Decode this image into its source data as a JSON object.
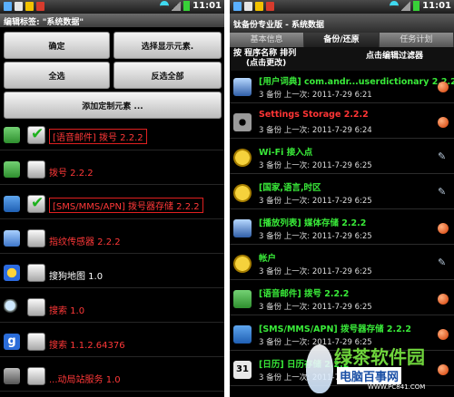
{
  "status": {
    "time": "11:01"
  },
  "left": {
    "title": "编辑标签: \"系统数据\"",
    "buttons": {
      "ok": "确定",
      "select_shown": "选择显示元素.",
      "select_all": "全选",
      "invert_all": "反选全部",
      "add_custom": "添加定制元素 ..."
    },
    "rows": [
      {
        "label": "[语音邮件] 拨号 2.2.2",
        "checked": true,
        "color": "red",
        "boxed": true,
        "icon": "phone-dialer-icon"
      },
      {
        "label": "拨号 2.2.2",
        "checked": false,
        "color": "red",
        "boxed": false,
        "icon": "phone-dialer-icon"
      },
      {
        "label": "[SMS/MMS/APN] 拨号器存储 2.2.2",
        "checked": true,
        "color": "red",
        "boxed": true,
        "icon": "phone-call-icon"
      },
      {
        "label": "指纹传感器 2.2.2",
        "checked": false,
        "color": "red",
        "boxed": false,
        "icon": "screen-icon"
      },
      {
        "label": "搜狗地图 1.0",
        "checked": false,
        "color": "white",
        "boxed": false,
        "icon": "sogou-map-icon"
      },
      {
        "label": "搜索 1.0",
        "checked": false,
        "color": "red",
        "boxed": false,
        "icon": "magnifier-icon"
      },
      {
        "label": "搜索 1.1.2.64376",
        "checked": false,
        "color": "red",
        "boxed": false,
        "icon": "google-icon"
      },
      {
        "label": "...动局站服务 1.0",
        "checked": false,
        "color": "red",
        "boxed": false,
        "icon": "app-icon"
      }
    ]
  },
  "right": {
    "title": "钛备份专业版 - 系统数据",
    "tabs": [
      "基本信息",
      "备份/还原",
      "任务计划"
    ],
    "sort": {
      "line1": "按 程序名称 排列",
      "line2": "(点击更改)",
      "filter": "点击编辑过滤器"
    },
    "apps": [
      {
        "name": "[用户词典] com.andr...userdictionary 2.2.2",
        "info": "3 备份 上一次: 2011-7-29 6:21",
        "color": "green",
        "mark": "dot",
        "icon": "monitor-icon"
      },
      {
        "name": "Settings Storage 2.2.2",
        "info": "3 备份 上一次: 2011-7-29 6:24",
        "color": "red",
        "mark": "dot",
        "icon": "gear-icon"
      },
      {
        "name": "Wi-Fi 接入点",
        "info": "3 备份 上一次: 2011-7-29 6:25",
        "color": "green",
        "mark": "pen",
        "icon": "sys-badge-icon"
      },
      {
        "name": "[国家,语言,时区",
        "info": "3 备份 上一次: 2011-7-29 6:25",
        "color": "green",
        "mark": "pen",
        "icon": "sys-badge-icon"
      },
      {
        "name": "[播放列表] 媒体存储 2.2.2",
        "info": "3 备份 上一次: 2011-7-29 6:25",
        "color": "green",
        "mark": "dot",
        "icon": "monitor-icon"
      },
      {
        "name": "帐户",
        "info": "3 备份 上一次: 2011-7-29 6:25",
        "color": "green",
        "mark": "pen",
        "icon": "sys-badge-icon"
      },
      {
        "name": "[语音邮件] 拨号 2.2.2",
        "info": "3 备份 上一次: 2011-7-29 6:25",
        "color": "green",
        "mark": "dot",
        "icon": "phone-dialer-icon"
      },
      {
        "name": "[SMS/MMS/APN] 拨号器存储 2.2.2",
        "info": "3 备份 上一次: 2011-7-29 6:25",
        "color": "green",
        "mark": "dot",
        "icon": "phone-call-icon"
      },
      {
        "name": "[日历] 日历存储 2.2.2",
        "info": "3 备份 上一次: 2011-7-29 6:25",
        "color": "green",
        "mark": "dot",
        "icon": "calendar-icon"
      }
    ],
    "calendar_day": "31"
  },
  "watermark": {
    "brand": "绿茶软件园",
    "site": "电脑百事网",
    "url": "WWW.PC841.COM"
  }
}
